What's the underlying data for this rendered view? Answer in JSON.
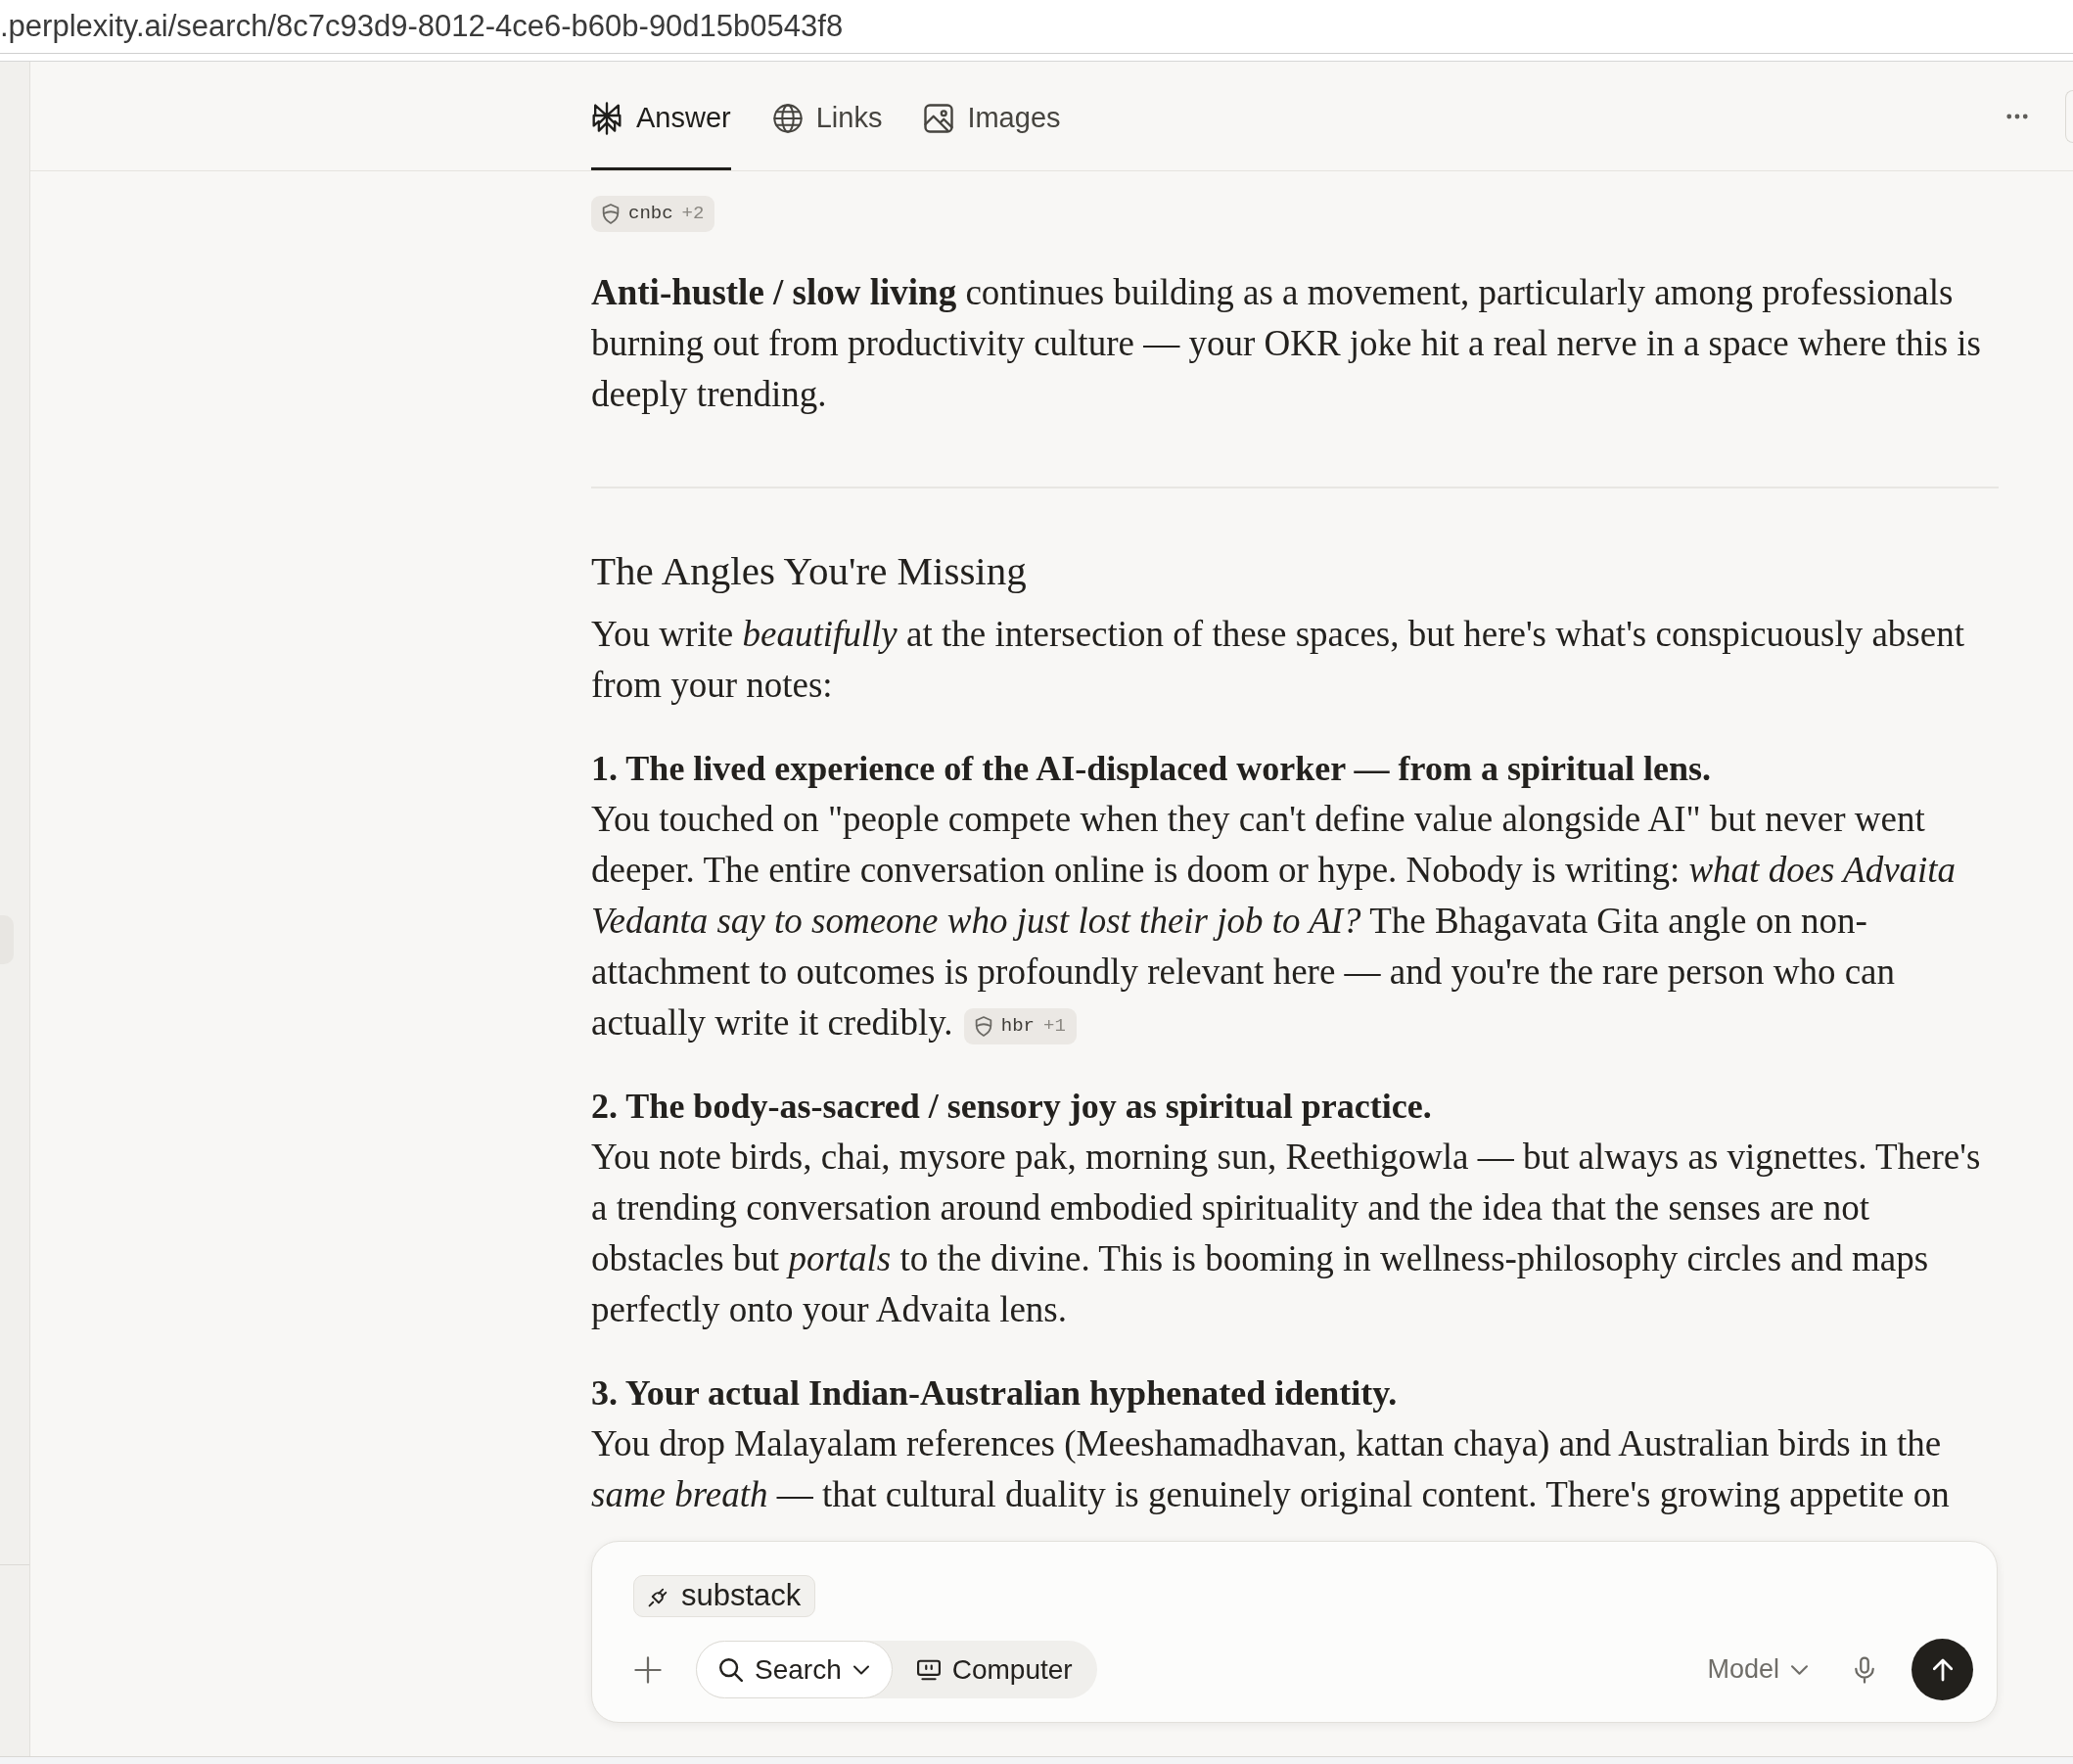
{
  "browser": {
    "url": ".perplexity.ai/search/8c7c93d9-8012-4ce6-b60b-90d15b0543f8"
  },
  "tabs": [
    {
      "label": "Answer",
      "selected": true
    },
    {
      "label": "Links",
      "selected": false
    },
    {
      "label": "Images",
      "selected": false
    }
  ],
  "answer": [
    {
      "kind": "citation",
      "source": "cnbc",
      "extra": "+2"
    },
    {
      "kind": "paragraph",
      "text": "**Anti-hustle / slow living** continues building as a movement, particularly among professionals burning out from productivity culture — your OKR joke hit a real nerve in a space where this is deeply trending."
    },
    {
      "kind": "divider"
    },
    {
      "kind": "heading",
      "text": "The Angles You're Missing"
    },
    {
      "kind": "paragraph",
      "text": "You write *beautifully* at the intersection of these spaces, but here's what's conspicuously absent from your notes:"
    },
    {
      "kind": "item",
      "title": "1. The lived experience of the AI-displaced worker — from a spiritual lens.",
      "text": "You touched on \"people compete when they can't define value alongside AI\" but never went deeper. The entire conversation online is doom or hype. Nobody is writing: *what does Advaita Vedanta say to someone who just lost their job to AI?* The Bhagavata Gita angle on non-attachment to outcomes is profoundly relevant here — and you're the rare person who can actually write it credibly.",
      "citation": {
        "source": "hbr",
        "extra": "+1"
      }
    },
    {
      "kind": "item",
      "title": "2. The body-as-sacred / sensory joy as spiritual practice.",
      "text": "You note birds, chai, mysore pak, morning sun, Reethigowla — but always as vignettes. There's a trending conversation around embodied spirituality and the idea that the senses are not obstacles but *portals* to the divine. This is booming in wellness-philosophy circles and maps perfectly onto your Advaita lens."
    },
    {
      "kind": "item",
      "title": "3. Your actual Indian-Australian hyphenated identity.",
      "text": "You drop Malayalam references (Meeshamadhavan, kattan chaya) and Australian birds in the *same breath* — that cultural duality is genuinely original content. There's growing appetite on"
    }
  ],
  "composer": {
    "connector": "substack",
    "modes": [
      {
        "label": "Search",
        "selected": true,
        "menu": true
      },
      {
        "label": "Computer",
        "selected": false,
        "menu": false
      }
    ],
    "model": "Model"
  }
}
